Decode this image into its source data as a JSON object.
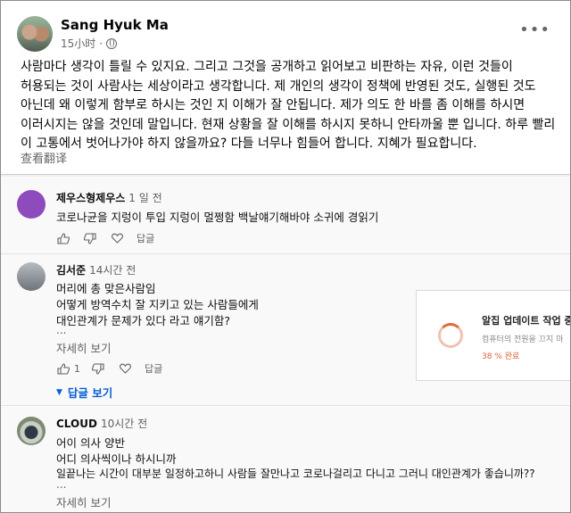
{
  "post": {
    "author": "Sang Hyuk Ma",
    "time": "15小时",
    "more": "•••",
    "text": "사람마다 생각이 틀릴 수 있지요. 그리고 그것을 공개하고 읽어보고 비판하는 자유, 이런 것들이 허용되는 것이 사람사는 세상이라고 생각합니다. 제 개인의 생각이 정책에 반영된 것도, 실행된 것도 아닌데 왜 이렇게 함부로 하시는 것인 지 이해가 잘 안됩니다. 제가 의도 한 바를 좀 이해를 하시면 이러시지는 않을 것인데 말입니다. 현재 상황을 잘 이해를 하시지 못하니 안타까울 뿐 입니다. 하루 빨리 이 고통에서 벗어나가야 하지 않을까요? 다들 너무나 힘들어 합니다. 지혜가 필요합니다.",
    "translate": "查看翻译"
  },
  "comments": [
    {
      "author": "제우스형제우스",
      "time": "1 일 전",
      "lines": [
        "코로나균을 지렁이 투입 지렁이 멀쩡함 백날얘기해바야 소귀에 경읽기"
      ],
      "likes": "",
      "reply_label": "답글"
    },
    {
      "author": "김서준",
      "time": "14시간 전",
      "lines": [
        "머리에 총 맞은사람임",
        "어떻게 방역수치 잘 지키고 있는 사람들에게",
        "대인관계가 문제가 있다 라고 얘기함?"
      ],
      "ellipsis": "...",
      "more_label": "자세히 보기",
      "likes": "1",
      "reply_label": "답글",
      "replies_label": "답글 보기"
    },
    {
      "author": "CLOUD",
      "time": "10시간 전",
      "lines": [
        "어이 의사 양반",
        "어디 의사씩이나 하시니까",
        "일끝나는 시간이 대부분 일정하고하니 사람들 잘만나고 코로나걸리고 다니고 그러니 대인관계가 좋습니까??"
      ],
      "ellipsis": "...",
      "more_label": "자세히 보기"
    }
  ],
  "popup": {
    "title": "알집 업데이트 작업 중",
    "subtitle": "컴퓨터의 전원을 끄지 마",
    "progress": "38 % 완료",
    "progress_value": 38
  }
}
